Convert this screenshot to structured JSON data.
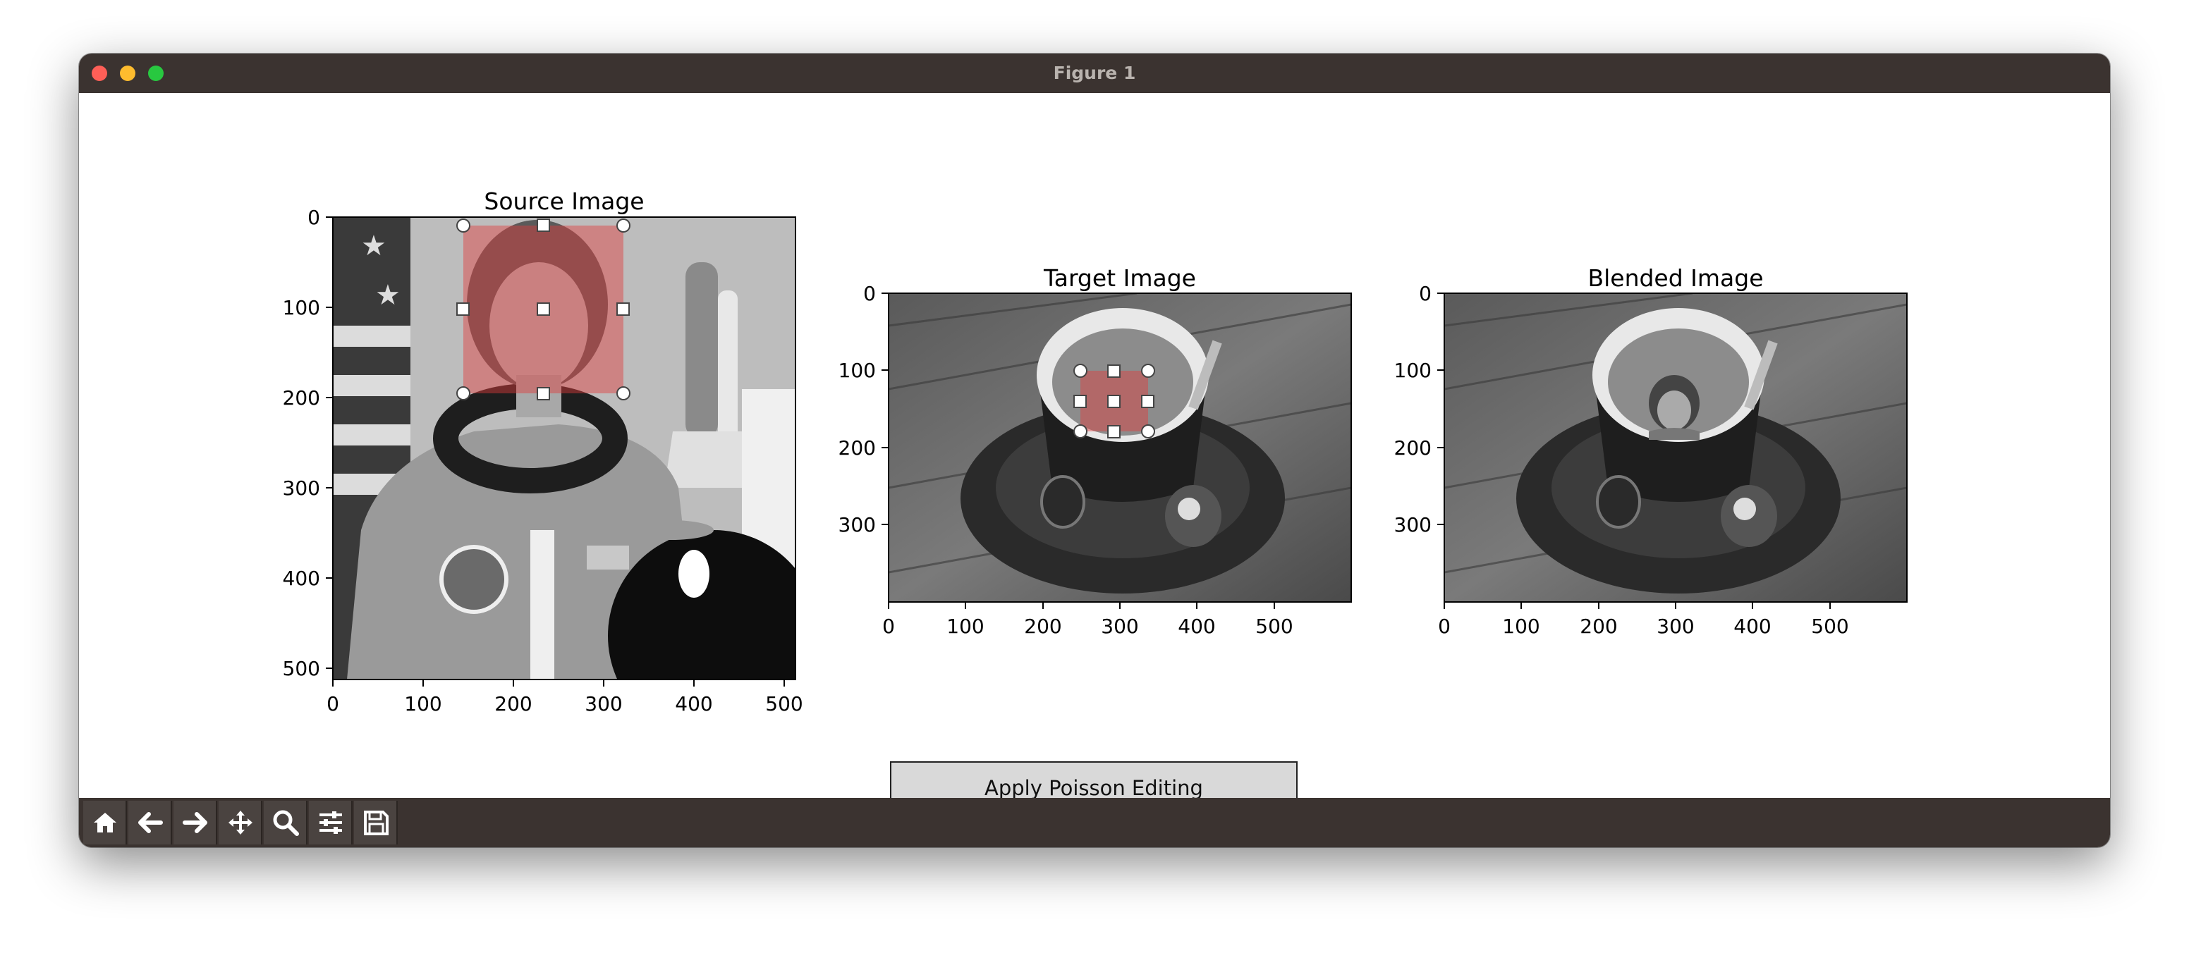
{
  "window": {
    "title": "Figure 1"
  },
  "panels": [
    {
      "title": "Source Image",
      "xticks": [
        "0",
        "100",
        "200",
        "300",
        "400",
        "500"
      ],
      "yticks": [
        "0",
        "100",
        "200",
        "300",
        "400",
        "500"
      ]
    },
    {
      "title": "Target Image",
      "xticks": [
        "0",
        "100",
        "200",
        "300",
        "400",
        "500"
      ],
      "yticks": [
        "0",
        "100",
        "200",
        "300"
      ]
    },
    {
      "title": "Blended Image",
      "xticks": [
        "0",
        "100",
        "200",
        "300",
        "400",
        "500"
      ],
      "yticks": [
        "0",
        "100",
        "200",
        "300"
      ]
    }
  ],
  "button": {
    "label": "Apply Poisson Editing"
  },
  "colors": {
    "selection": "#e05a5a",
    "titlebar": "#3b3330",
    "button_bg": "#d9d9d9"
  },
  "toolbar": {
    "icons": [
      "home-icon",
      "back-arrow-icon",
      "forward-arrow-icon",
      "pan-move-icon",
      "zoom-magnifier-icon",
      "configure-subplots-icon",
      "save-disk-icon"
    ]
  }
}
